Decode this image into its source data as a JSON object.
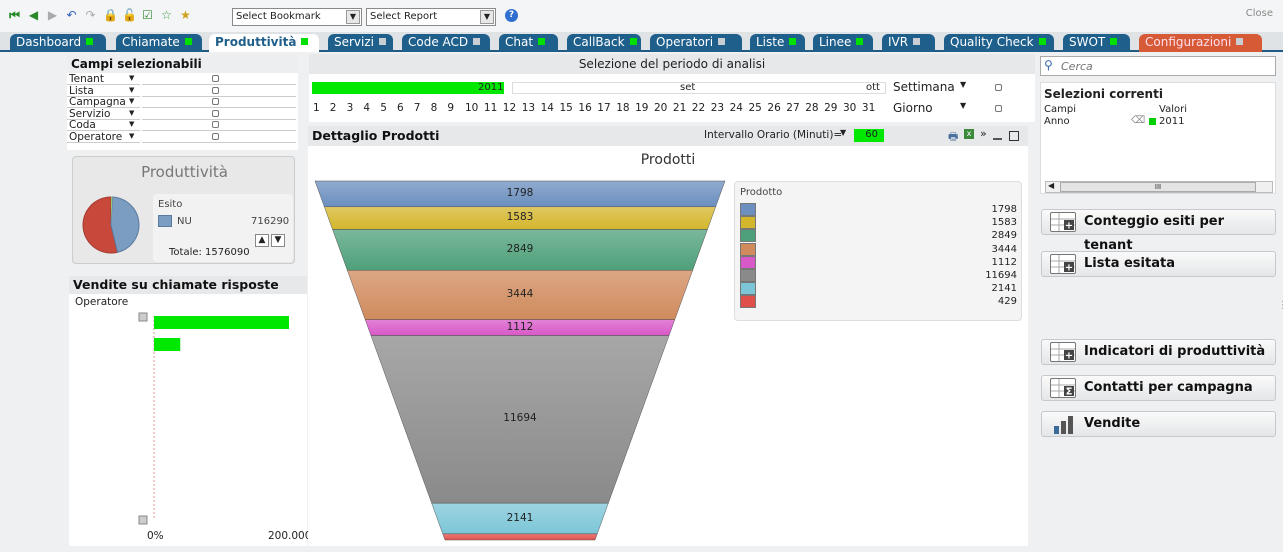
{
  "toolbar": {
    "bookmark_select": "Select Bookmark",
    "report_select": "Select Report",
    "close_label": "Close"
  },
  "tabs": [
    {
      "label": "Dashboard",
      "indicator": "#00e000"
    },
    {
      "label": "Chiamate",
      "indicator": "#00e000"
    },
    {
      "label": "Produttività",
      "indicator": "#00e000"
    },
    {
      "label": "Servizi",
      "indicator": "#c9ced4"
    },
    {
      "label": "Code ACD",
      "indicator": "#c9ced4"
    },
    {
      "label": "Chat",
      "indicator": "#00e000"
    },
    {
      "label": "CallBack",
      "indicator": "#00e000"
    },
    {
      "label": "Operatori",
      "indicator": "#c9ced4"
    },
    {
      "label": "Liste",
      "indicator": "#00e000"
    },
    {
      "label": "Linee",
      "indicator": "#00e000"
    },
    {
      "label": "IVR",
      "indicator": "#c9ced4"
    },
    {
      "label": "Quality Check",
      "indicator": "#00e000"
    },
    {
      "label": "SWOT",
      "indicator": "#00e000"
    },
    {
      "label": "Configurazioni",
      "indicator": "#c9ced4"
    }
  ],
  "campi": {
    "title": "Campi selezionabili",
    "fields": [
      "Tenant",
      "Lista",
      "Campagna",
      "Servizio",
      "Coda",
      "Operatore"
    ]
  },
  "produttivita": {
    "title": "Produttività",
    "legend_title": "Esito",
    "item_label": "NU",
    "item_value": "716290",
    "total": "Totale: 1576090",
    "share_nu": 0.4545,
    "colors": {
      "nu": "#7b9dc2",
      "other": "#c8483b",
      "thin": "#9bc76a"
    }
  },
  "vendite": {
    "title": "Vendite su chiamate risposte",
    "dimension_label": "Operatore",
    "axis_min": "0%",
    "axis_max": "200.000",
    "bars": [
      180000,
      35000
    ]
  },
  "periodo": {
    "title": "Selezione del periodo di analisi",
    "year_selected": "2011",
    "months": [
      "set",
      "ott"
    ],
    "week_label": "Settimana",
    "day_label": "Giorno",
    "days": [
      "1",
      "2",
      "3",
      "4",
      "5",
      "6",
      "7",
      "8",
      "9",
      "10",
      "11",
      "12",
      "13",
      "14",
      "15",
      "16",
      "17",
      "18",
      "19",
      "20",
      "21",
      "22",
      "23",
      "24",
      "25",
      "26",
      "27",
      "28",
      "29",
      "30",
      "31"
    ]
  },
  "dettaglio": {
    "title": "Dettaglio Prodotti",
    "interval_label": "Intervallo Orario (Minuti)=",
    "interval_value": "60"
  },
  "chart_data": {
    "type": "funnel",
    "title": "Prodotti",
    "legend_title": "Prodotto",
    "values": [
      1798,
      1583,
      2849,
      3444,
      1112,
      11694,
      2141,
      429
    ],
    "colors": [
      "#6b8fbf",
      "#d4b62c",
      "#4ea07a",
      "#d08a5c",
      "#d858c8",
      "#8a8a8a",
      "#7cc6d8",
      "#e0504a"
    ]
  },
  "search": {
    "placeholder": "Cerca"
  },
  "selezioni": {
    "title": "Selezioni correnti",
    "col_fields": "Campi",
    "col_values": "Valori",
    "row_field": "Anno",
    "row_value": "2011",
    "scroll_thumb": "III"
  },
  "buttons": [
    {
      "label": "Conteggio esiti per tenant",
      "icon": "table-icon"
    },
    {
      "label": "Lista esitata",
      "icon": "table-icon"
    },
    {
      "label": "Indicatori di produttività",
      "icon": "table-icon"
    },
    {
      "label": "Contatti per campagna",
      "icon": "sum-table-icon"
    },
    {
      "label": "Vendite",
      "icon": "bar-chart-icon"
    }
  ]
}
